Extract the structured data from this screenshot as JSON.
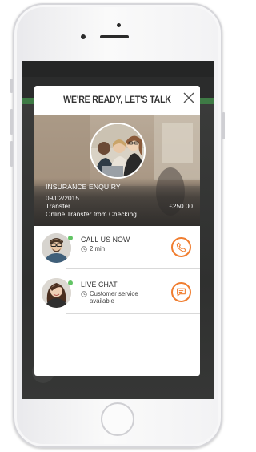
{
  "modal": {
    "title": "WE'RE READY, LET'S TALK"
  },
  "transaction": {
    "title": "INSURANCE ENQUIRY",
    "date": "09/02/2015",
    "type": "Transfer",
    "description": "Online Transfer from Checking",
    "amount": "£250.00"
  },
  "contacts": [
    {
      "label": "CALL US NOW",
      "meta": [
        "2 min"
      ],
      "icon": "phone-icon",
      "status": "online"
    },
    {
      "label": "LIVE CHAT",
      "meta": [
        "Customer service",
        "available"
      ],
      "icon": "chat-bubble-icon",
      "status": "online"
    }
  ],
  "colors": {
    "accent": "#f07d2f",
    "online": "#62c465",
    "brand_green": "#3e7a45",
    "title_text": "#333333"
  }
}
